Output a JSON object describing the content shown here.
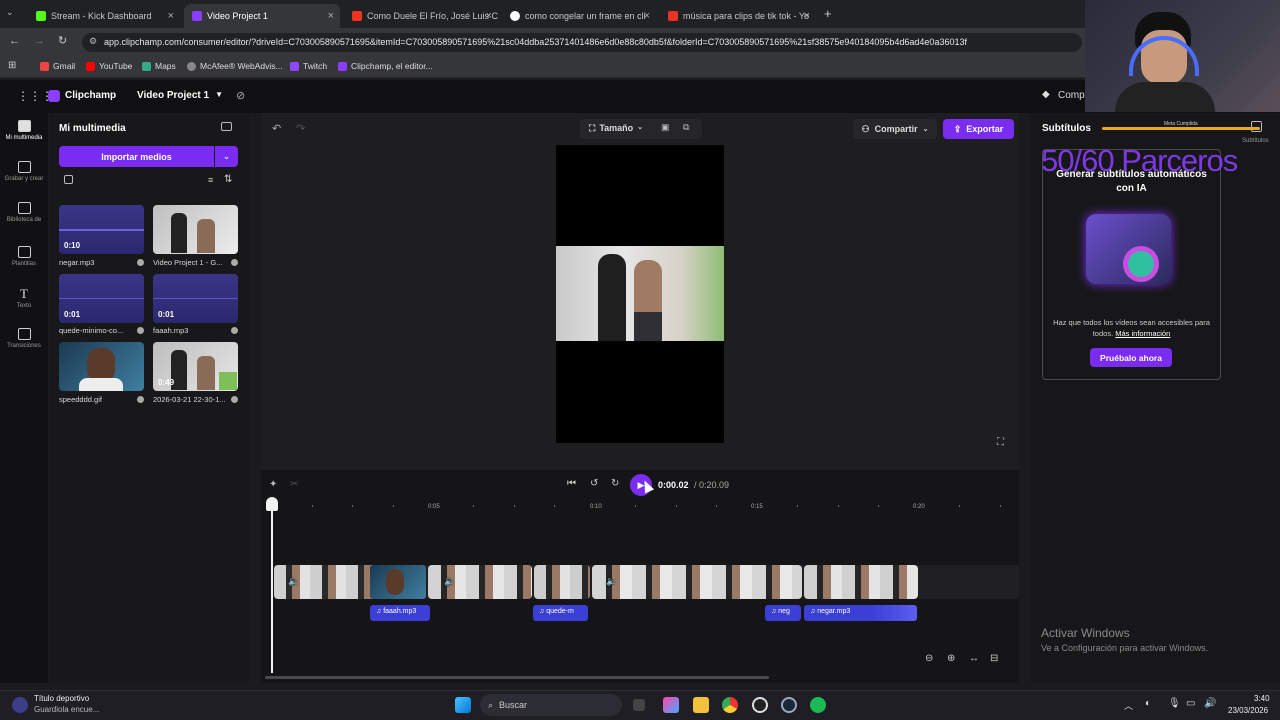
{
  "browser": {
    "tabs": [
      {
        "title": "Stream - Kick Dashboard",
        "active": false
      },
      {
        "title": "Video Project 1",
        "active": true
      },
      {
        "title": "Como Duele El Frío, José Luis C",
        "active": false
      },
      {
        "title": "como congelar un frame en cli",
        "active": false
      },
      {
        "title": "música para clips de tik tok - Yo",
        "active": false
      }
    ],
    "url": "app.clipchamp.com/consumer/editor/?driveId=C703005890571695&itemId=C703005890571695%21sc04ddba25371401486e6d0e88c80db5f&folderId=C703005890571695%21sf38575e940184095b4d6ad4e0a36013f",
    "bookmarks": [
      "Gmail",
      "YouTube",
      "Maps",
      "McAfee® WebAdvis...",
      "Twitch",
      "Clipchamp, el editor..."
    ]
  },
  "app": {
    "brand": "Clipchamp",
    "project_name": "Video Project 1",
    "premium_label": "Compr"
  },
  "rail": [
    "Mi multimedia",
    "Grabar y crear",
    "Biblioteca de",
    "Plantillas",
    "Texto",
    "Transiciones"
  ],
  "media": {
    "title": "Mi multimedia",
    "import_label": "Importar medios",
    "items": [
      {
        "label": "negar.mp3",
        "duration": "0:10",
        "kind": "audio"
      },
      {
        "label": "Video Project 1 - G...",
        "duration": "",
        "kind": "video"
      },
      {
        "label": "quede-minimo-co...",
        "duration": "0:01",
        "kind": "audio"
      },
      {
        "label": "faaah.mp3",
        "duration": "0:01",
        "kind": "audio"
      },
      {
        "label": "speedddd.gif",
        "duration": "",
        "kind": "gif"
      },
      {
        "label": "2026-03-21 22-30-1...",
        "duration": "0:49",
        "kind": "video"
      }
    ]
  },
  "toolbar": {
    "size_label": "Tamaño",
    "share_label": "Compartir",
    "export_label": "Exportar"
  },
  "playback": {
    "current": "0:00.02",
    "total": "/ 0:20.09",
    "ticks": [
      "0:05",
      "0:10",
      "0:15",
      "0:20"
    ]
  },
  "audio_clips": [
    "faaah.mp3",
    "quede-m",
    "neg",
    "negar.mp3"
  ],
  "subtitles": {
    "title": "Subtítulos",
    "overlay_label": "Subtítulos",
    "headline": "Generar subtítulos automáticos con IA",
    "body": "Haz que todos los vídeos sean accesibles para todos.",
    "link": "Más información",
    "cta": "Pruébalo ahora"
  },
  "stream_overlay": {
    "goal_text": "50/60 Parceros",
    "meta_label": "Meta Cumplida"
  },
  "watermark": {
    "line1": "Activar Windows",
    "line2": "Ve a Configuración para activar Windows."
  },
  "taskbar": {
    "notif_title": "Título deportivo",
    "notif_sub": "Guardiola encue...",
    "search": "Buscar",
    "time": "3:40",
    "date": "23/03/2026"
  },
  "colors": {
    "accent": "#7a2cf0",
    "audio_clip": "#3c3fd6",
    "overlay_text": "#8b3dff"
  }
}
